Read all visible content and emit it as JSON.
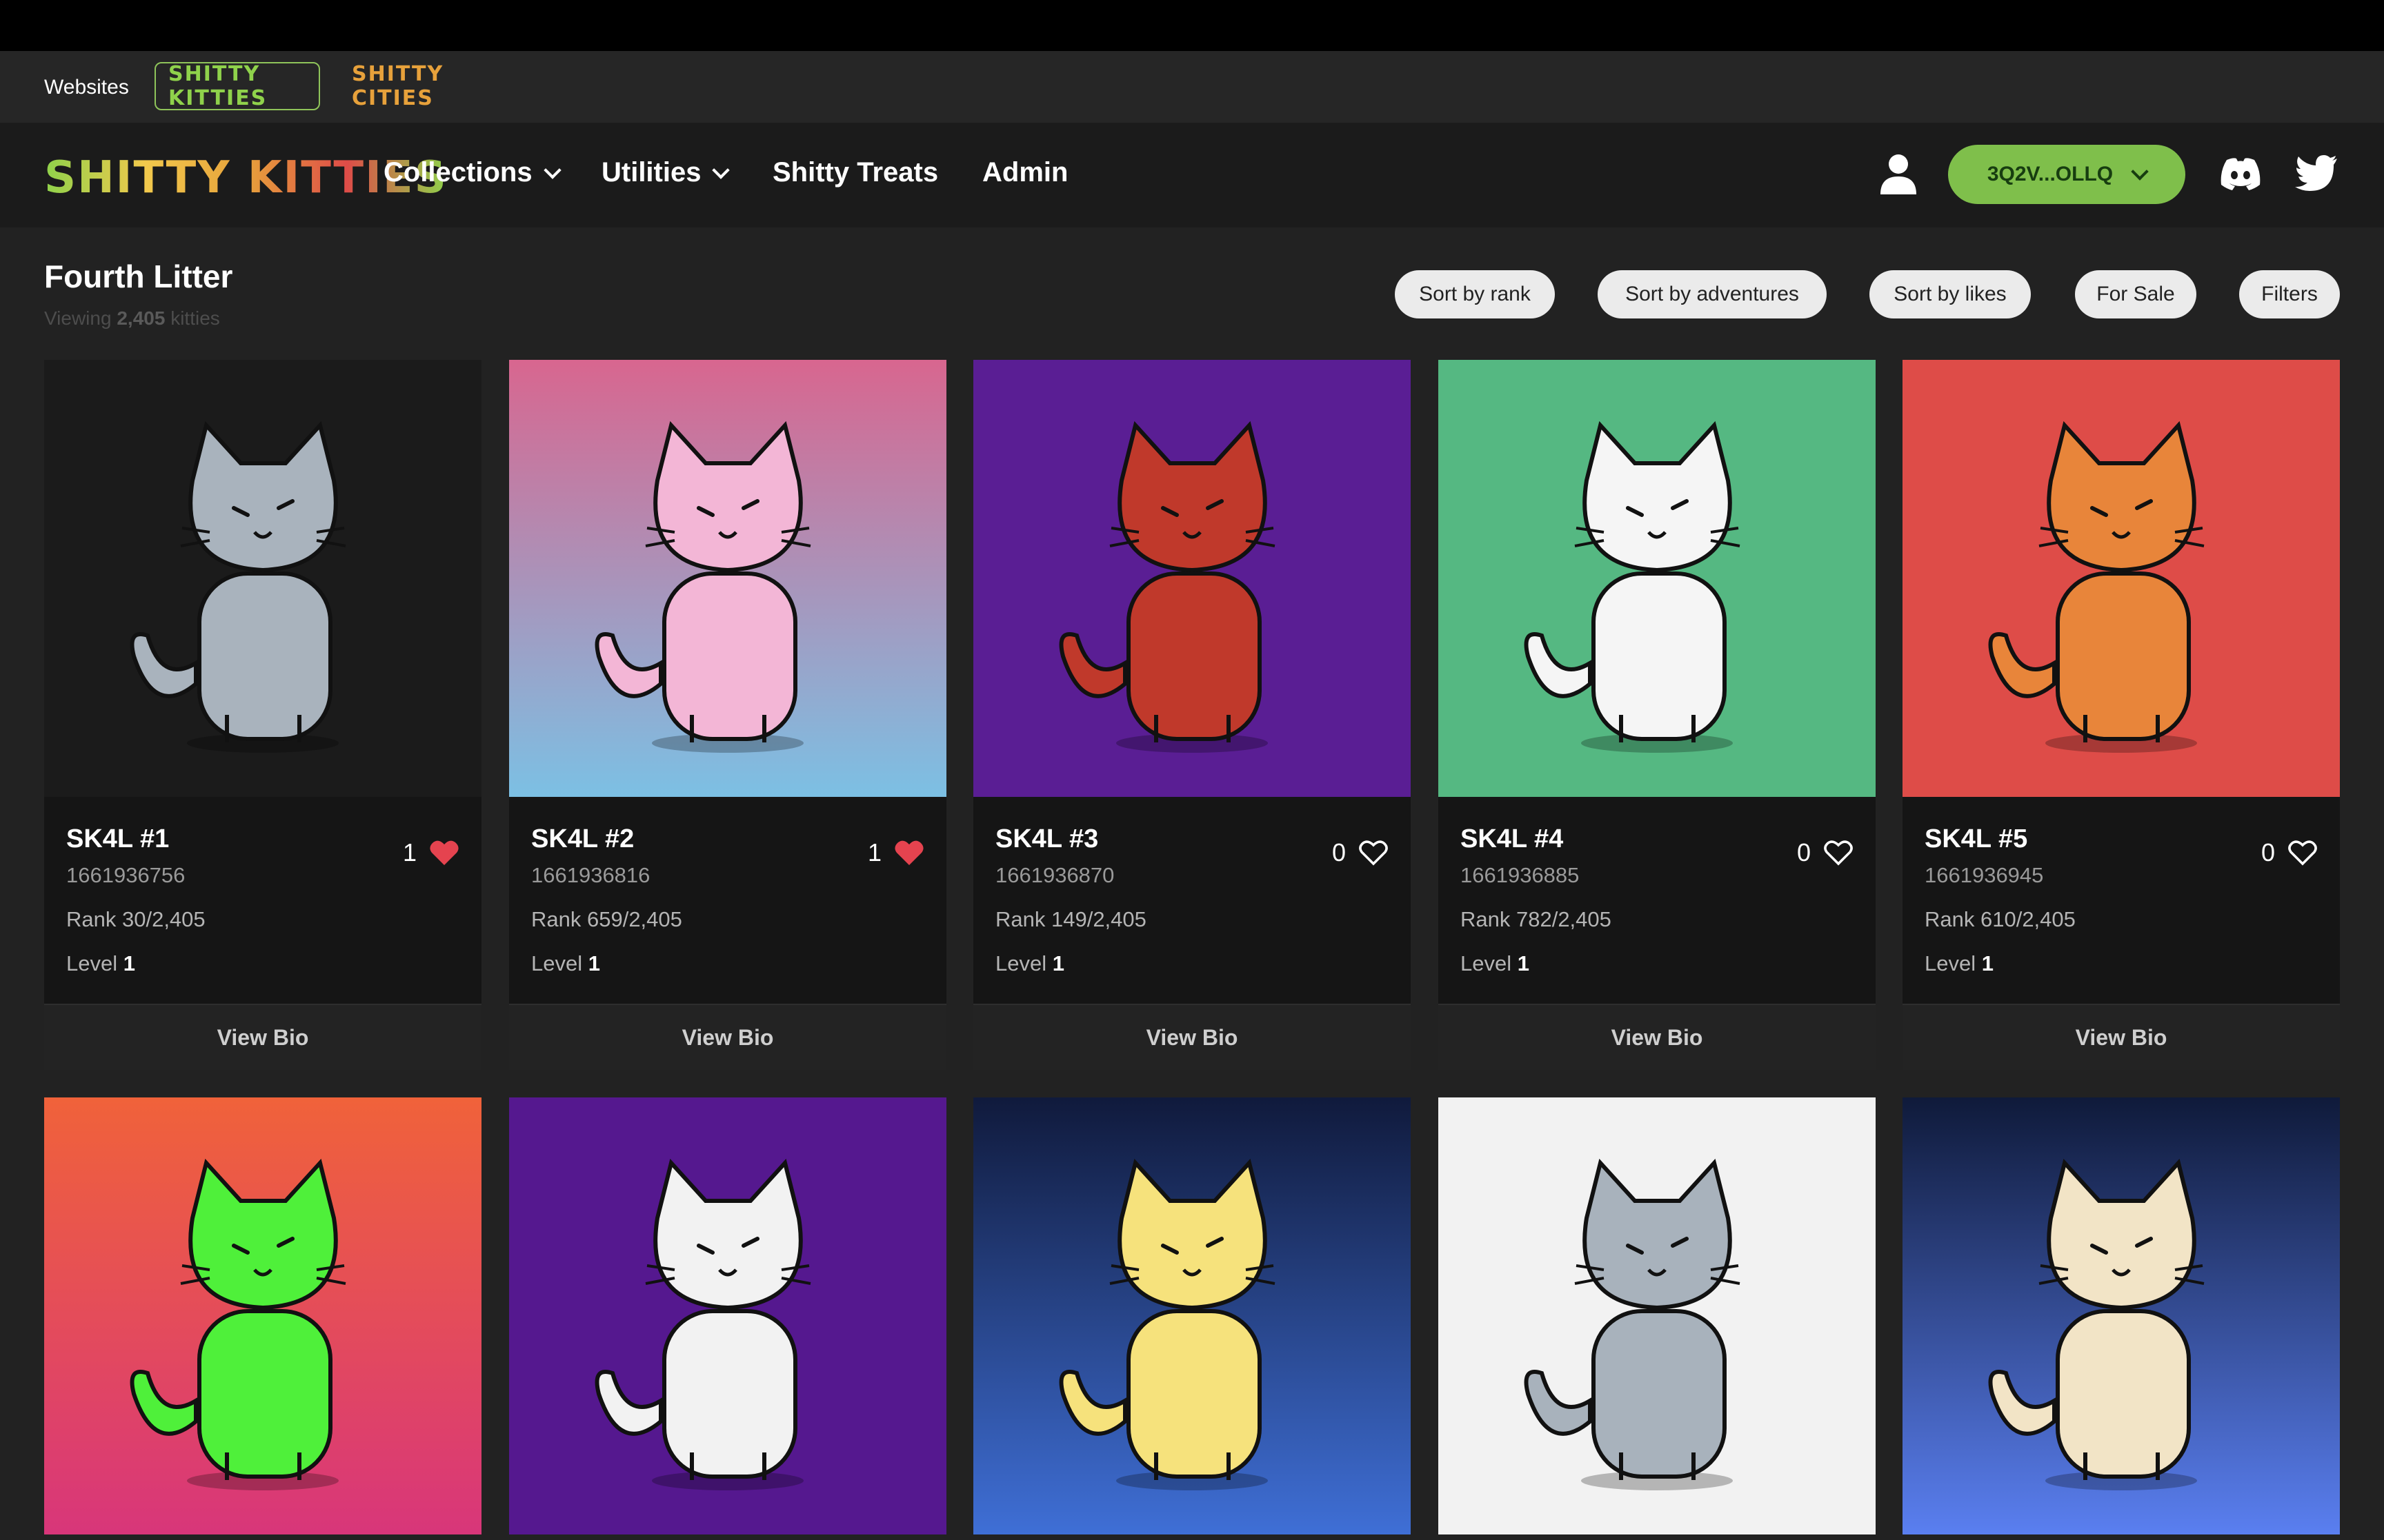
{
  "sites": {
    "label": "Websites",
    "items": [
      {
        "label": "SHITTY KITTIES",
        "active": true
      },
      {
        "label": "SHITTY CITIES",
        "active": false
      }
    ]
  },
  "nav": {
    "logo": "SHITTY KITTIES",
    "items": [
      {
        "label": "Collections",
        "dropdown": true
      },
      {
        "label": "Utilities",
        "dropdown": true
      },
      {
        "label": "Shitty Treats",
        "dropdown": false
      },
      {
        "label": "Admin",
        "dropdown": false
      }
    ],
    "wallet": "3Q2V...OLLQ",
    "icons": [
      "user-icon",
      "discord-icon",
      "twitter-icon"
    ]
  },
  "page": {
    "title": "Fourth Litter",
    "viewing_prefix": "Viewing",
    "viewing_count": "2,405",
    "viewing_suffix": "kitties"
  },
  "sort_buttons": [
    "Sort by rank",
    "Sort by adventures",
    "Sort by likes",
    "For Sale",
    "Filters"
  ],
  "cards": [
    {
      "name": "SK4L #1",
      "timestamp": "1661936756",
      "rank": "Rank 30/2,405",
      "level_label": "Level",
      "level": "1",
      "likes": "1",
      "liked": true,
      "bg": "#1b1b1b",
      "body": "#a9b3bd",
      "bio": "View Bio"
    },
    {
      "name": "SK4L #2",
      "timestamp": "1661936816",
      "rank": "Rank 659/2,405",
      "level_label": "Level",
      "level": "1",
      "likes": "1",
      "liked": true,
      "bg": "linear-gradient(180deg,#d8668f,#7cc0e4)",
      "body": "#f3b6d6",
      "bio": "View Bio"
    },
    {
      "name": "SK4L #3",
      "timestamp": "1661936870",
      "rank": "Rank 149/2,405",
      "level_label": "Level",
      "level": "1",
      "likes": "0",
      "liked": false,
      "bg": "#5a1e94",
      "body": "#c0392b",
      "bio": "View Bio"
    },
    {
      "name": "SK4L #4",
      "timestamp": "1661936885",
      "rank": "Rank 782/2,405",
      "level_label": "Level",
      "level": "1",
      "likes": "0",
      "liked": false,
      "bg": "#55b882",
      "body": "#f5f5f5",
      "bio": "View Bio"
    },
    {
      "name": "SK4L #5",
      "timestamp": "1661936945",
      "rank": "Rank 610/2,405",
      "level_label": "Level",
      "level": "1",
      "likes": "0",
      "liked": false,
      "bg": "#de4c48",
      "body": "#e8853a",
      "bio": "View Bio"
    }
  ],
  "row2_art": [
    {
      "bg": "linear-gradient(180deg,#f0623a,#d8367a)",
      "body": "#4ff03a"
    },
    {
      "bg": "#55188f",
      "body": "#f2f2f2"
    },
    {
      "bg": "linear-gradient(180deg,#101a3c,#3f6fd6)",
      "body": "#f6e27c"
    },
    {
      "bg": "#f2f2f2",
      "body": "#a8b2bc"
    },
    {
      "bg": "linear-gradient(180deg,#0f1a3a,#5a7ff0)",
      "body": "#f2e4c6"
    }
  ],
  "colors": {
    "accent": "#7fbf4b",
    "like": "#e5434f"
  }
}
